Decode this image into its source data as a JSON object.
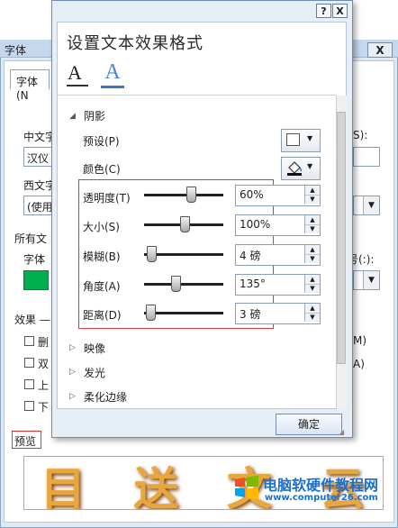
{
  "background_dialog": {
    "title": "字体",
    "close_label": "X",
    "tab_label": "字体(N",
    "chinese_font_label": "中文字",
    "chinese_font_value": "汉仪",
    "western_font_label": "西文字",
    "western_font_value": "(使用",
    "all_text_label": "所有文",
    "font_color_label": "字体",
    "size_suffix_label": "S):",
    "size_hint_label": "号(:):",
    "effects_label": "效果 —",
    "effect_checks": [
      "删",
      "双",
      "上",
      "下"
    ],
    "right_labels": [
      "M)",
      "A)"
    ],
    "preview_label": "预览",
    "preview_art": "目 送 文 云",
    "font_color": "#00b050"
  },
  "watermark": {
    "title": "电脑软硬件教程网",
    "url": "www.computer26.com"
  },
  "dialog": {
    "help_label": "?",
    "close_label": "X",
    "title": "设置文本效果格式",
    "tab_font_icon": "A",
    "tab_effect_icon": "A",
    "shadow": {
      "header": "阴影",
      "preset_label": "预设(P)",
      "color_label": "颜色(C)",
      "rows": [
        {
          "label": "透明度(T)",
          "value": "60%",
          "level": 0.6
        },
        {
          "label": "大小(S)",
          "value": "100%",
          "level": 0.5
        },
        {
          "label": "模糊(B)",
          "value": "4 磅",
          "level": 0.04
        },
        {
          "label": "角度(A)",
          "value": "135°",
          "level": 0.375
        },
        {
          "label": "距离(D)",
          "value": "3 磅",
          "level": 0.03
        }
      ]
    },
    "sections": [
      "映像",
      "发光",
      "柔化边缘"
    ],
    "ok_label": "确定",
    "accent_color": "#3c77c7",
    "highlight_color": "#d23c3c"
  }
}
